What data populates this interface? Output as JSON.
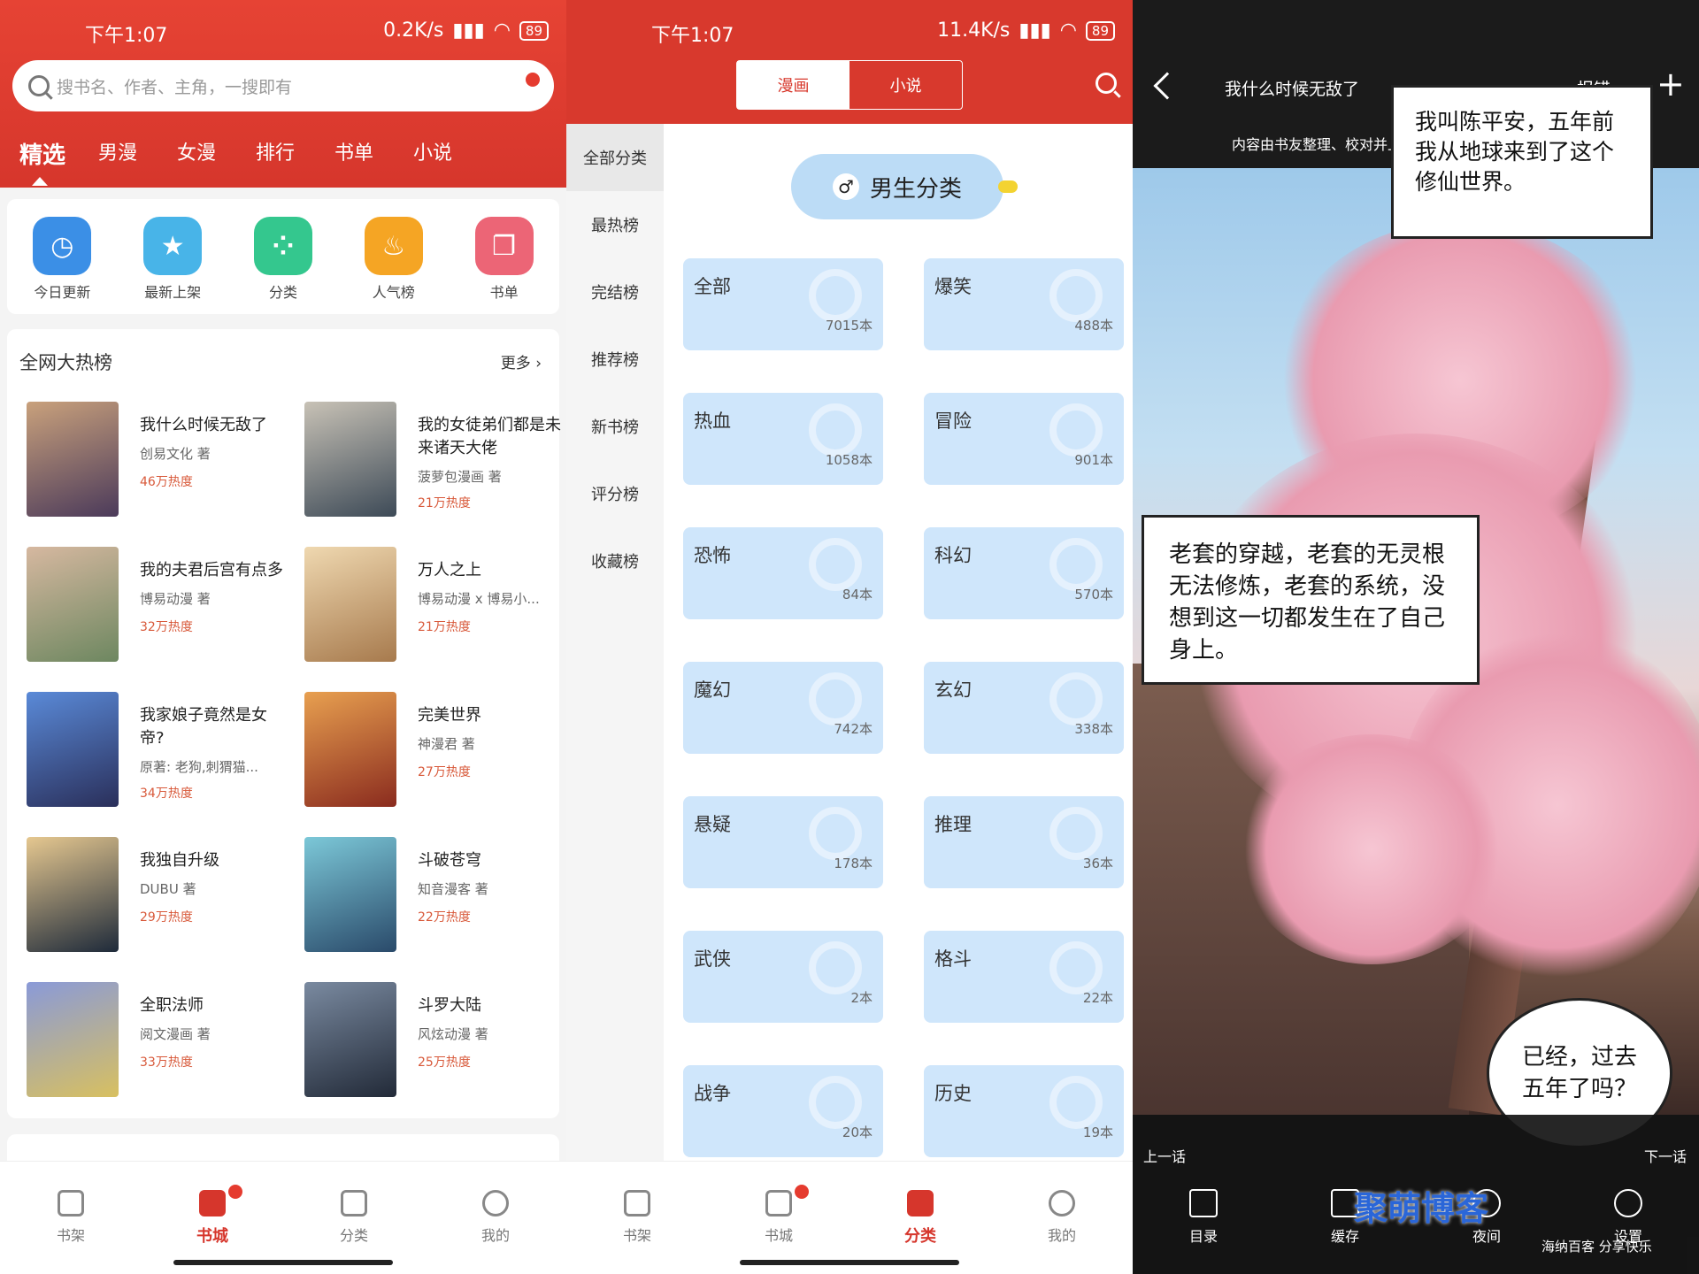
{
  "panel1": {
    "status": {
      "time": "下午1:07",
      "speed": "0.2K/s",
      "battery": "89"
    },
    "search_placeholder": "搜书名、作者、主角，一搜即有",
    "tabs": [
      "精选",
      "男漫",
      "女漫",
      "排行",
      "书单",
      "小说"
    ],
    "quick": [
      {
        "label": "今日更新",
        "icon": "clock-icon",
        "color": "#3b8fe6",
        "glyph": "◷"
      },
      {
        "label": "最新上架",
        "icon": "star-box-icon",
        "color": "#48b4e8",
        "glyph": "★"
      },
      {
        "label": "分类",
        "icon": "grid-icon",
        "color": "#34c78e",
        "glyph": "⁘"
      },
      {
        "label": "人气榜",
        "icon": "fire-icon",
        "color": "#f5a524",
        "glyph": "♨"
      },
      {
        "label": "书单",
        "icon": "book-icon",
        "color": "#ec6576",
        "glyph": "❐"
      }
    ],
    "hot_title": "全网大热榜",
    "hot_more": "更多",
    "books": [
      {
        "title": "我什么时候无敌了",
        "author": "创易文化 著",
        "heat": "46万热度",
        "c1": "#c9a17c",
        "c2": "#4b3a5a"
      },
      {
        "title": "我的女徒弟们都是未来诸天大佬",
        "author": "菠萝包漫画 著",
        "heat": "21万热度",
        "c1": "#c8c2b6",
        "c2": "#3d4a57"
      },
      {
        "title": "我的夫君后宫有点多",
        "author": "博易动漫 著",
        "heat": "32万热度",
        "c1": "#d6b8a0",
        "c2": "#6d8760"
      },
      {
        "title": "万人之上",
        "author": "博易动漫 x 博易小...",
        "heat": "21万热度",
        "c1": "#efd8b0",
        "c2": "#a77a4d"
      },
      {
        "title": "我家娘子竟然是女帝?",
        "author": "原著: 老狗,刺猬猫...",
        "heat": "34万热度",
        "c1": "#5a8ad8",
        "c2": "#2a2f5a"
      },
      {
        "title": "完美世界",
        "author": "神漫君 著",
        "heat": "27万热度",
        "c1": "#e8a050",
        "c2": "#8a2b1e"
      },
      {
        "title": "我独自升级",
        "author": "DUBU 著",
        "heat": "29万热度",
        "c1": "#e6c890",
        "c2": "#1e2a3a"
      },
      {
        "title": "斗破苍穹",
        "author": "知音漫客 著",
        "heat": "22万热度",
        "c1": "#7cc8d8",
        "c2": "#2a4a6a"
      },
      {
        "title": "全职法师",
        "author": "阅文漫画 著",
        "heat": "33万热度",
        "c1": "#8a9ad8",
        "c2": "#d8c060"
      },
      {
        "title": "斗罗大陆",
        "author": "风炫动漫 著",
        "heat": "25万热度",
        "c1": "#7a8aa0",
        "c2": "#222a38"
      }
    ],
    "nav": [
      "书架",
      "书城",
      "分类",
      "我的"
    ]
  },
  "panel2": {
    "status": {
      "time": "下午1:07",
      "speed": "11.4K/s",
      "battery": "89"
    },
    "seg": [
      "漫画",
      "小说"
    ],
    "side": [
      "全部分类",
      "最热榜",
      "完结榜",
      "推荐榜",
      "新书榜",
      "评分榜",
      "收藏榜"
    ],
    "group_title": "男生分类",
    "cats": [
      {
        "name": "全部",
        "count": "7015本"
      },
      {
        "name": "爆笑",
        "count": "488本"
      },
      {
        "name": "热血",
        "count": "1058本"
      },
      {
        "name": "冒险",
        "count": "901本"
      },
      {
        "name": "恐怖",
        "count": "84本"
      },
      {
        "name": "科幻",
        "count": "570本"
      },
      {
        "name": "魔幻",
        "count": "742本"
      },
      {
        "name": "玄幻",
        "count": "338本"
      },
      {
        "name": "悬疑",
        "count": "178本"
      },
      {
        "name": "推理",
        "count": "36本"
      },
      {
        "name": "武侠",
        "count": "2本"
      },
      {
        "name": "格斗",
        "count": "22本"
      },
      {
        "name": "战争",
        "count": "20本"
      },
      {
        "name": "历史",
        "count": "19本"
      }
    ],
    "nav": [
      "书架",
      "书城",
      "分类",
      "我的"
    ]
  },
  "panel3": {
    "title": "我什么时候无敌了",
    "report": "报错",
    "note": "内容由书友整理、校对并上传，如有疑问请邮件我们",
    "bubble1": "我叫陈平安，五年前我从地球来到了这个修仙世界。",
    "bubble2": "老套的穿越，老套的无灵根无法修炼，老套的系统，没想到这一切都发生在了自己身上。",
    "bubble3": "已经，过去五年了吗？",
    "prev": "上一话",
    "next": "下一话",
    "tools": [
      "目录",
      "缓存",
      "夜间",
      "设置"
    ],
    "watermark": "聚萌博客",
    "watermark2": "海纳百客 分享快乐"
  }
}
